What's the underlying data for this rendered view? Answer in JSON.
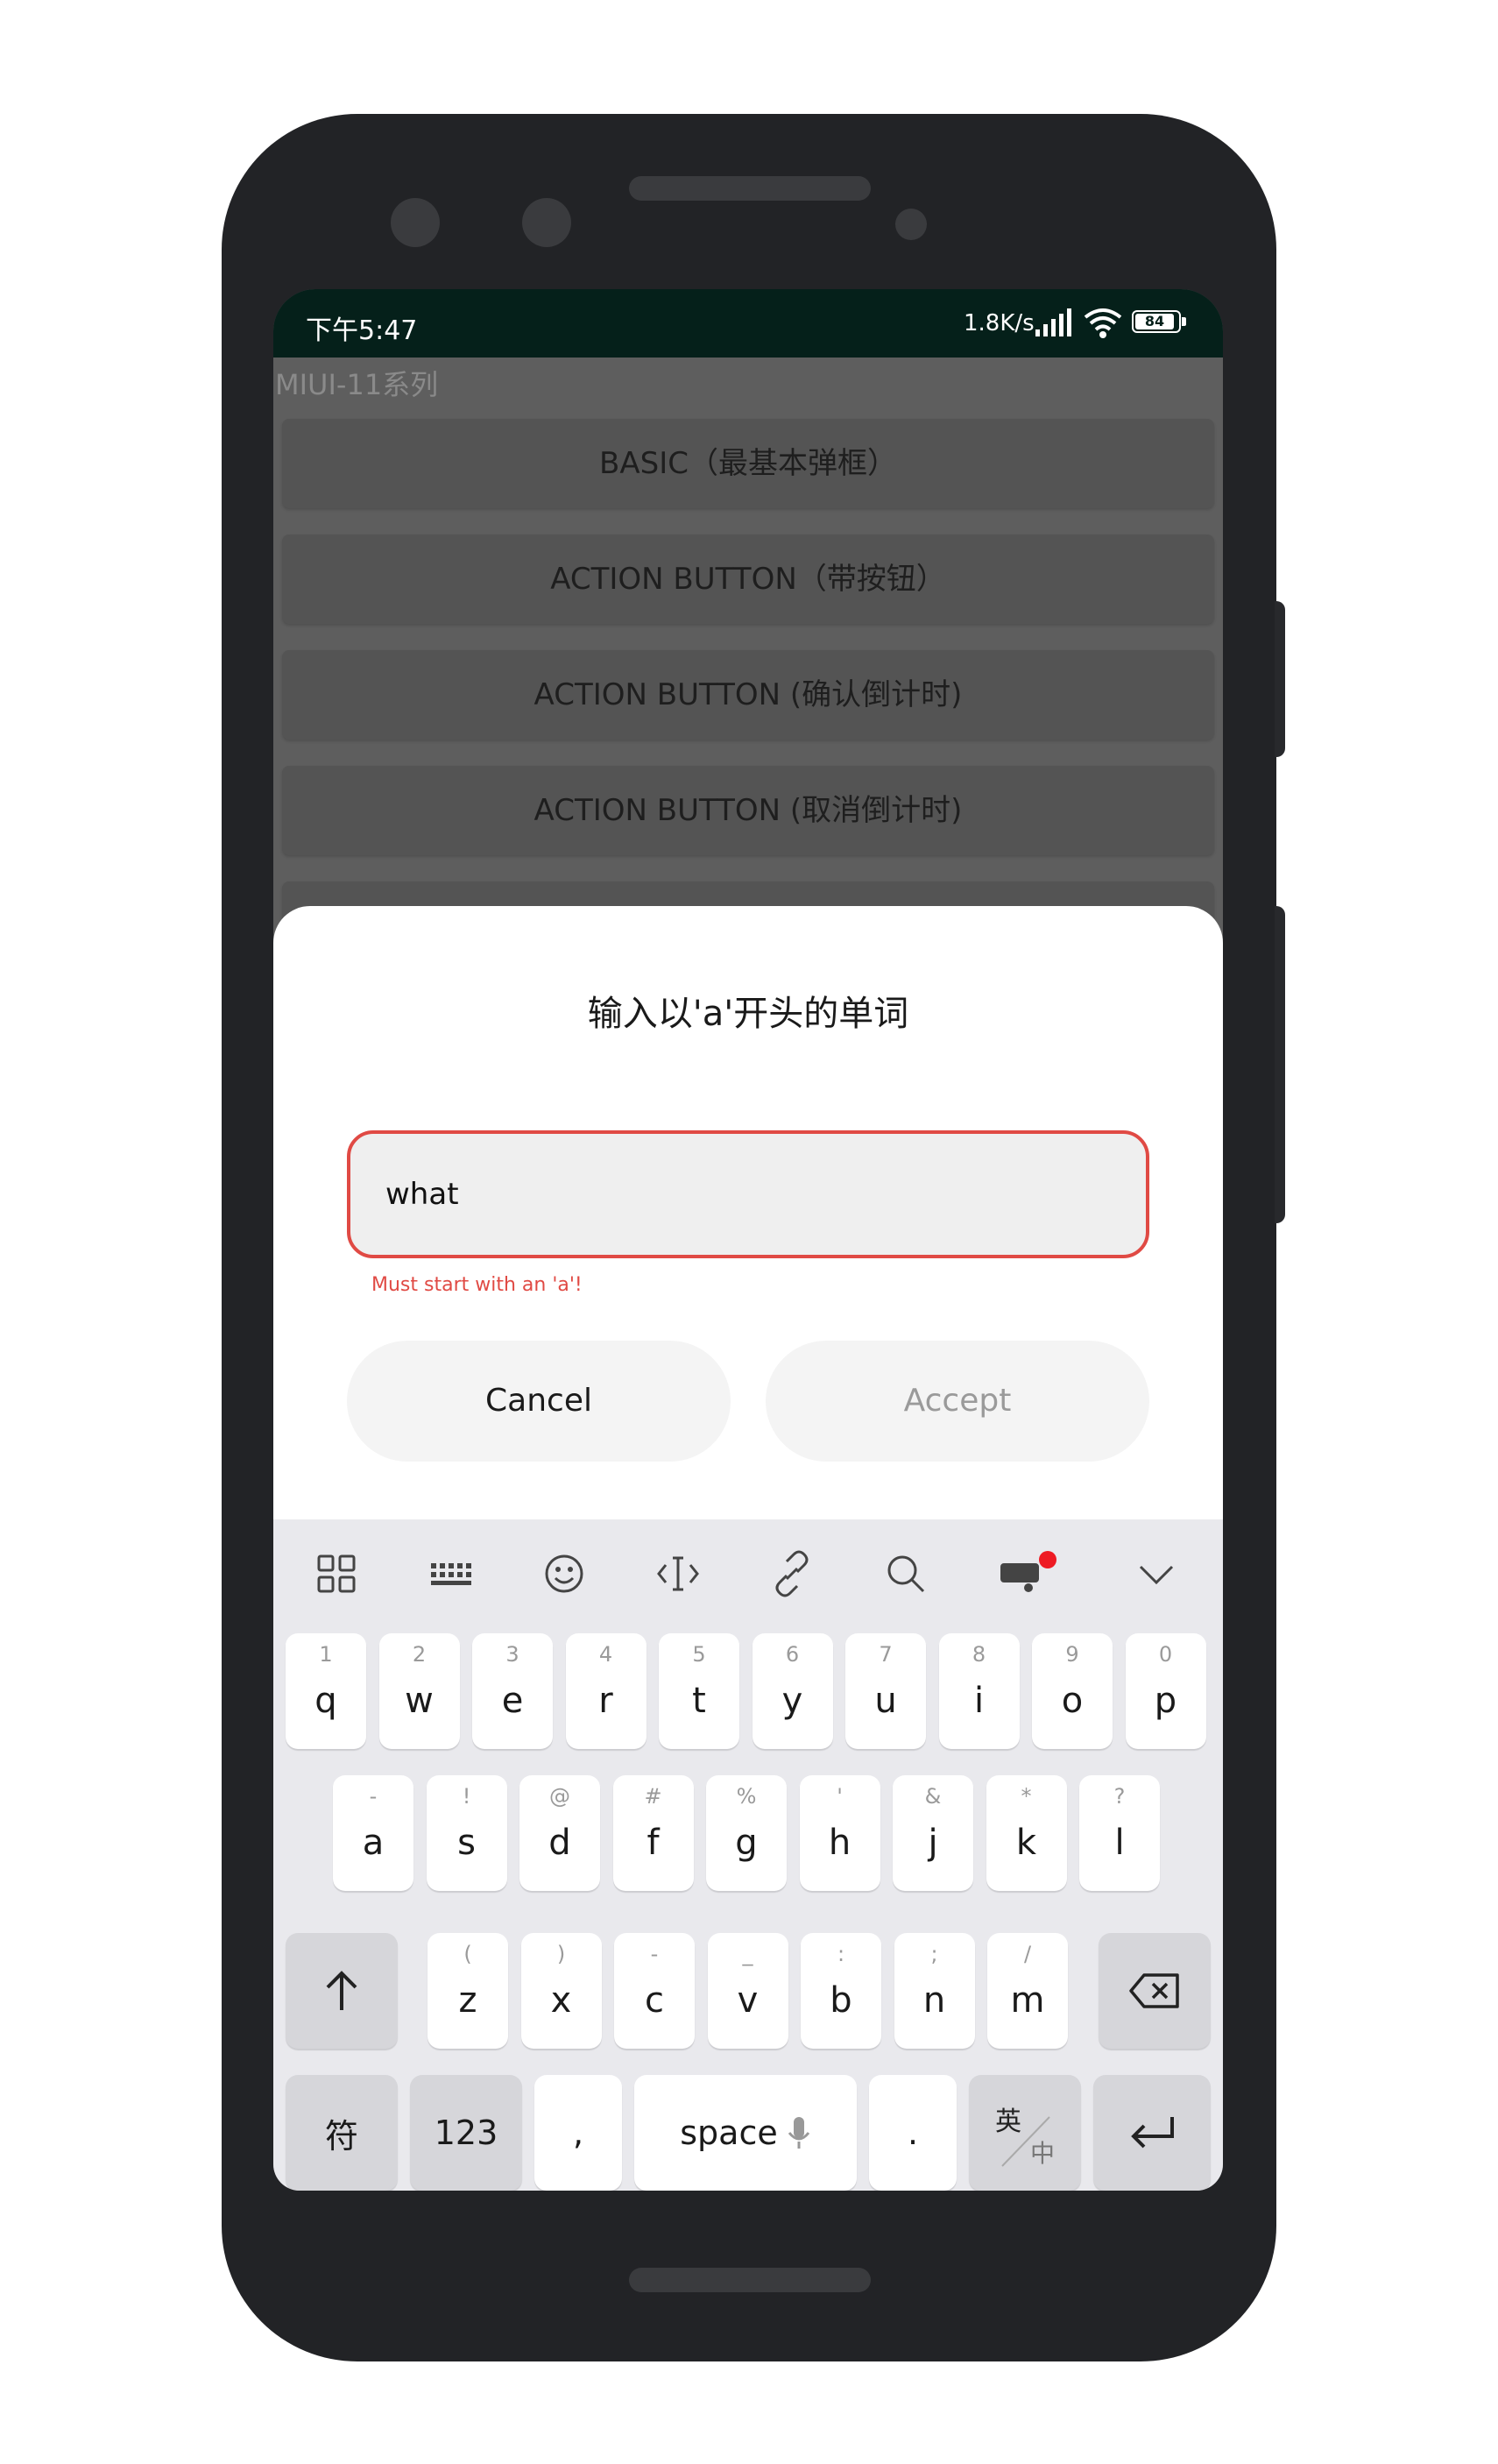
{
  "status_bar": {
    "time": "下午5:47",
    "net_speed": "1.8K/s",
    "battery": "84"
  },
  "app": {
    "title": "MIUI-11系列",
    "buttons": [
      "BASIC（最基本弹框）",
      "ACTION BUTTON（带按钮）",
      "ACTION BUTTON (确认倒计时)",
      "ACTION BUTTON (取消倒计时)"
    ]
  },
  "dialog": {
    "title": "输入以'a'开头的单词",
    "input_value": "what",
    "error_text": "Must start with an 'a'!",
    "cancel_label": "Cancel",
    "accept_label": "Accept"
  },
  "keyboard": {
    "toolbar": [
      "apps-grid-icon",
      "keyboard-layout-icon",
      "emoji-icon",
      "cursor-move-icon",
      "clipboard-link-icon",
      "search-icon",
      "comic-icon",
      "collapse-chevron-icon"
    ],
    "row1": [
      {
        "key": "q",
        "hint": "1"
      },
      {
        "key": "w",
        "hint": "2"
      },
      {
        "key": "e",
        "hint": "3"
      },
      {
        "key": "r",
        "hint": "4"
      },
      {
        "key": "t",
        "hint": "5"
      },
      {
        "key": "y",
        "hint": "6"
      },
      {
        "key": "u",
        "hint": "7"
      },
      {
        "key": "i",
        "hint": "8"
      },
      {
        "key": "o",
        "hint": "9"
      },
      {
        "key": "p",
        "hint": "0"
      }
    ],
    "row2": [
      {
        "key": "a",
        "hint": "-"
      },
      {
        "key": "s",
        "hint": "!"
      },
      {
        "key": "d",
        "hint": "@"
      },
      {
        "key": "f",
        "hint": "#"
      },
      {
        "key": "g",
        "hint": "%"
      },
      {
        "key": "h",
        "hint": "'"
      },
      {
        "key": "j",
        "hint": "&"
      },
      {
        "key": "k",
        "hint": "*"
      },
      {
        "key": "l",
        "hint": "?"
      }
    ],
    "row3": [
      {
        "key": "z",
        "hint": "("
      },
      {
        "key": "x",
        "hint": ")"
      },
      {
        "key": "c",
        "hint": "-"
      },
      {
        "key": "v",
        "hint": "_"
      },
      {
        "key": "b",
        "hint": ":"
      },
      {
        "key": "n",
        "hint": ";"
      },
      {
        "key": "m",
        "hint": "/"
      }
    ],
    "row4": {
      "symbols": "符",
      "numbers": "123",
      "comma": ",",
      "space": "space",
      "period": ".",
      "lang_top": "英",
      "lang_bottom": "中"
    }
  },
  "colors": {
    "error": "#e04a44",
    "status_bar": "#05201a",
    "scrim": "#5e5e5e"
  }
}
